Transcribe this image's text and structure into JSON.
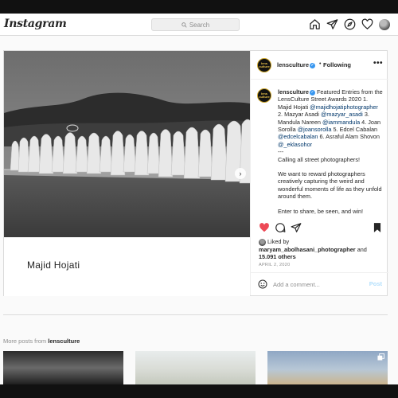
{
  "app": {
    "logo_text": "Instagram",
    "search_placeholder": "Search"
  },
  "nav": {
    "icons": [
      "home-icon",
      "direct-messages-icon",
      "explore-compass-icon",
      "activity-heart-icon",
      "profile-avatar"
    ]
  },
  "post": {
    "username": "lensculture",
    "avatar_text": "lens culture",
    "separator": "•",
    "follow_status": "Following",
    "more_label": "•••",
    "photo_caption_name": "Majid Hojati",
    "caption": {
      "username": "lensculture",
      "intro": "Featured Entries from the LensCulture Street Awards 2020",
      "entries": [
        {
          "prefix": "1. Majid Hojati",
          "handle": "@majidhojatiphotographer"
        },
        {
          "prefix": "2. Mazyar Asadi",
          "handle": "@mazyar_asadi"
        },
        {
          "prefix": "3. Mandula Nareen",
          "handle": "@iammandula"
        },
        {
          "prefix": "4. Joan Sorolla",
          "handle": "@joansorolla"
        },
        {
          "prefix": "5. Edcel Cabalan",
          "handle": "@edcelcabalan"
        },
        {
          "prefix": "6. Asraful Alam Shovon",
          "handle": "@_eklasohor"
        }
      ],
      "separator_line": "---",
      "call_line": "Calling all street photographers!",
      "body": "We want to reward photographers creatively capturing the weird and wonderful moments of life as they unfold around them.",
      "overflow_text": "Enter to share, be seen, and win!"
    },
    "likes": {
      "prefix": "Liked by",
      "user": "maryam_abolhasani_photographer",
      "connector": "and",
      "others": "15.091 others"
    },
    "date": "APRIL 2, 2020",
    "comment_placeholder": "Add a comment...",
    "post_button": "Post",
    "liked": true
  },
  "more_posts": {
    "prefix": "More posts from",
    "username": "lensculture"
  },
  "colors": {
    "like_red": "#ed4956",
    "link_blue": "#00376b",
    "verified_blue": "#3897f0",
    "post_button_disabled": "#b2dffc"
  }
}
